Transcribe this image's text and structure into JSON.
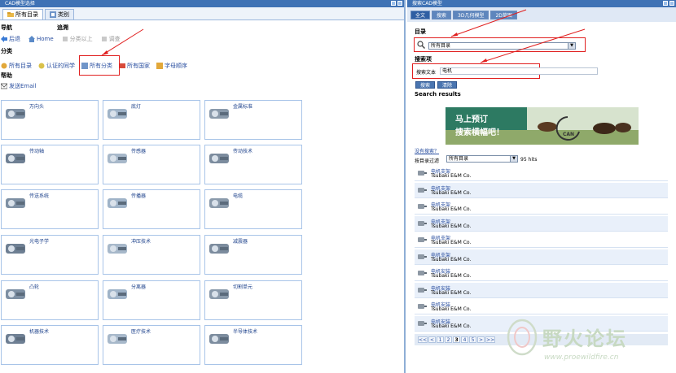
{
  "left": {
    "title": "CAD模型选择",
    "tabs": [
      {
        "label": "所有目录",
        "icon": "folder-icon"
      },
      {
        "label": "类别",
        "icon": "category-icon"
      }
    ],
    "nav_label": "导航",
    "tools_label": "追溯",
    "nav_items": [
      {
        "label": "后退",
        "icon": "back-arrow-icon",
        "enabled": true
      },
      {
        "label": "Home",
        "icon": "home-icon",
        "enabled": true
      },
      {
        "label": "分类以上",
        "icon": "up-level-icon",
        "enabled": false
      },
      {
        "label": "调查",
        "icon": "survey-icon",
        "enabled": false
      }
    ],
    "category_label": "分类",
    "category_items": [
      {
        "label": "所有目录",
        "icon": "catalog-icon"
      },
      {
        "label": "认证的同学",
        "icon": "certified-icon"
      },
      {
        "label": "所有分类",
        "icon": "all-categories-icon"
      },
      {
        "label": "所有国家",
        "icon": "country-icon"
      },
      {
        "label": "字母顺序",
        "icon": "alphabet-icon"
      }
    ],
    "help_label": "帮助",
    "email_label": "发送Email",
    "tiles": [
      {
        "name": "万向头",
        "icon": "universal-joint-icon"
      },
      {
        "name": "底灯",
        "icon": "lamp-icon"
      },
      {
        "name": "金属标准",
        "icon": "metal-standard-icon"
      },
      {
        "name": "传动轴",
        "icon": "drive-shaft-icon"
      },
      {
        "name": "传感器",
        "icon": "sensor-icon"
      },
      {
        "name": "传动技术",
        "icon": "drive-tech-icon"
      },
      {
        "name": "传送系统",
        "icon": "conveyor-icon"
      },
      {
        "name": "传播器",
        "icon": "spreader-icon"
      },
      {
        "name": "电缆",
        "icon": "cable-icon"
      },
      {
        "name": "光电子学",
        "icon": "optoelectronics-icon"
      },
      {
        "name": "冲压技术",
        "icon": "press-tech-icon"
      },
      {
        "name": "减震器",
        "icon": "damper-icon"
      },
      {
        "name": "凸轮",
        "icon": "cam-icon"
      },
      {
        "name": "分离器",
        "icon": "separator-icon"
      },
      {
        "name": "切割单元",
        "icon": "cutting-unit-icon"
      },
      {
        "name": "机器技术",
        "icon": "machine-tech-icon"
      },
      {
        "name": "医疗技术",
        "icon": "medical-tech-icon"
      },
      {
        "name": "半导体技术",
        "icon": "semiconductor-icon"
      }
    ]
  },
  "right": {
    "title": "搜索CAD模型",
    "tabs": [
      "全文",
      "搜索",
      "3D几何模型",
      "2D草图"
    ],
    "catalog_label": "目录",
    "catalog_value": "所有目录",
    "search_section_label": "搜索项",
    "search_text_label": "搜索文本",
    "search_text_value": "电机",
    "search_button": "搜索",
    "reset_button": "清除",
    "results_label": "Search results",
    "banner_line1": "马上预订",
    "banner_line2": "搜索横幅吧！",
    "banner_brand": "CAN",
    "tips_link": "没有搜索？",
    "filter_label": "按目录过滤",
    "filter_value": "所有目录",
    "hits_text": "95 hits",
    "results": [
      {
        "title": "电机支架",
        "company": "Tsubaki E&M Co."
      },
      {
        "title": "电机支架",
        "company": "Tsubaki E&M Co."
      },
      {
        "title": "电机支架",
        "company": "Tsubaki E&M Co."
      },
      {
        "title": "电机支架",
        "company": "Tsubaki E&M Co."
      },
      {
        "title": "电机支架",
        "company": "Tsubaki E&M Co."
      },
      {
        "title": "电机支架",
        "company": "Tsubaki E&M Co."
      },
      {
        "title": "电机安装",
        "company": "Tsubaki E&M Co."
      },
      {
        "title": "电机安装",
        "company": "Tsubaki E&M Co."
      },
      {
        "title": "电机安装",
        "company": "Tsubaki E&M Co."
      },
      {
        "title": "电机安装",
        "company": "Tsubaki E&M Co."
      }
    ],
    "pager": [
      "<<",
      "<",
      "1",
      "2",
      "3",
      "4",
      "5",
      ">",
      ">>"
    ],
    "current_page": "3"
  },
  "watermark": {
    "text": "野火论坛",
    "url": "www.proewildfire.cn"
  }
}
